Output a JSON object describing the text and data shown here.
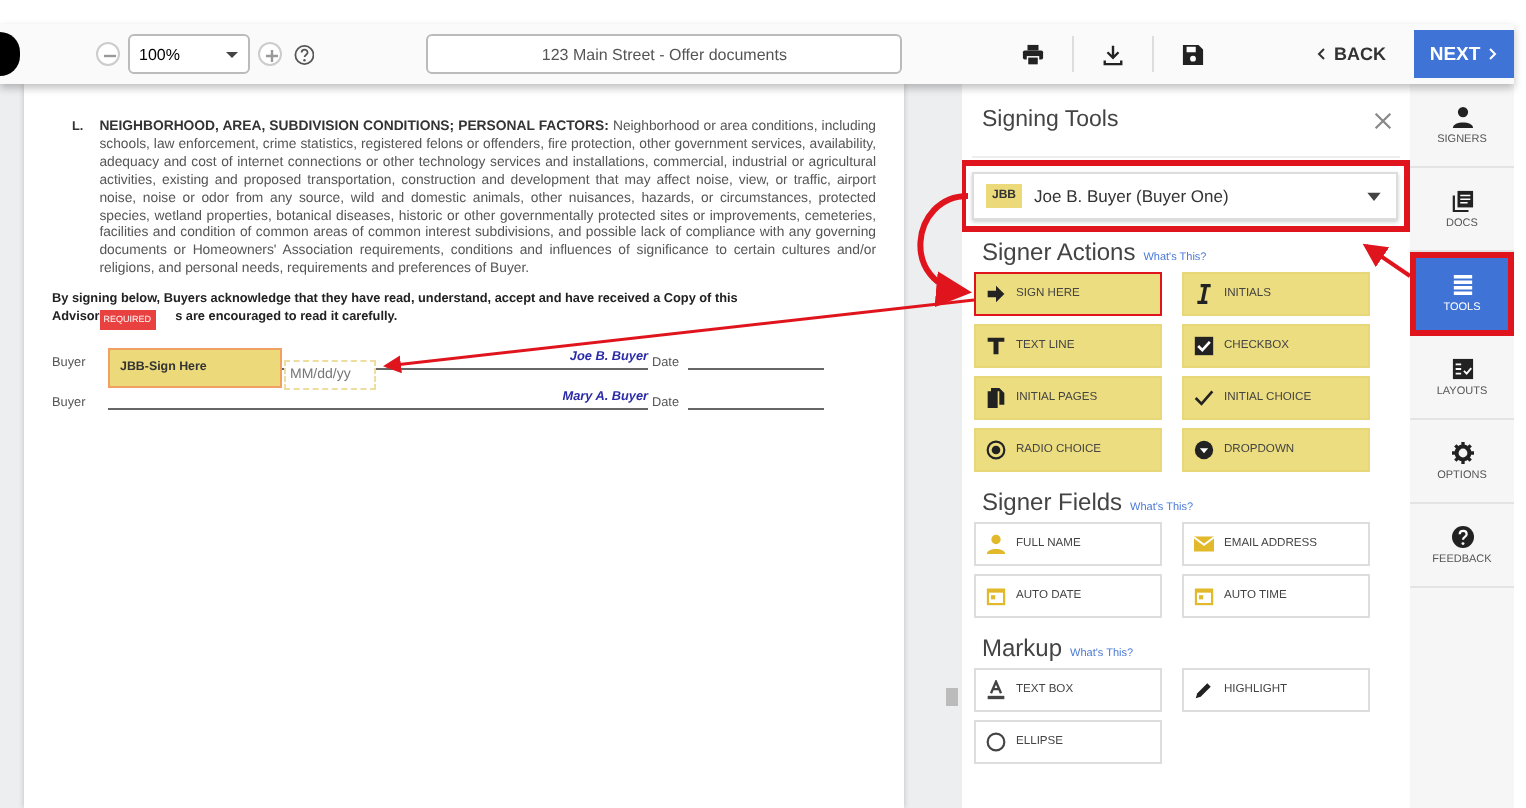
{
  "toolbar": {
    "zoom": "100%",
    "document_title": "123 Main Street - Offer documents",
    "back": "BACK",
    "next": "NEXT"
  },
  "document": {
    "letter": "L.",
    "paragraph": "**NEIGHBORHOOD, AREA, SUBDIVISION CONDITIONS; PERSONAL FACTORS:** Neighborhood or area conditions, including schools, law enforcement, crime statistics, registered felons or offenders, fire protection, other government services, availability, adequacy and cost of internet connections or other technology services and installations, commercial, industrial or agricultural activities, existing and proposed transportation, construction and development that may affect noise, view, or traffic, airport noise, noise or odor from any source, wild and domestic animals, other nuisances, hazards, or circumstances, protected species, wetland properties, botanical diseases, historic or other governmentally protected sites or improvements, cemeteries, facilities and condition of common areas of common interest subdivisions, and possible lack of compliance with any governing documents or Homeowners' Association requirements, conditions and influences of significance to certain cultures and/or religions, and personal needs, requirements and preferences of Buyer.",
    "acknowledgement_start": "By signing below, Buyers acknowledge that they have read, understand, accept and have received a Copy of this",
    "acknowledgement_line2_start": "Advisor",
    "required_badge": "REQUIRED",
    "acknowledgement_line2_end": "s are encouraged to read it carefully.",
    "sign_field": {
      "label": "JBB-Sign Here"
    },
    "date_field": {
      "placeholder": "MM/dd/yy"
    },
    "signature_rows": [
      {
        "label": "Buyer",
        "signer": "Joe B. Buyer",
        "date_label": "Date"
      },
      {
        "label": "Buyer",
        "signer": "Mary A. Buyer",
        "date_label": "Date"
      }
    ]
  },
  "panel": {
    "title": "Signing Tools",
    "signer": {
      "initials": "JBB",
      "name": "Joe B. Buyer (Buyer One)",
      "highlighted": true
    },
    "sections": [
      {
        "title": "Signer Actions",
        "help": "What's This?",
        "kind": "filled",
        "tools": [
          {
            "label": "SIGN HERE",
            "kind": "arrow",
            "highlighted": true
          },
          {
            "label": "INITIALS",
            "kind": "cursor",
            "highlighted": false
          },
          {
            "label": "TEXT LINE",
            "kind": "text",
            "highlighted": false
          },
          {
            "label": "CHECKBOX",
            "kind": "checkbox",
            "highlighted": false
          },
          {
            "label": "INITIAL PAGES",
            "kind": "pages",
            "highlighted": false
          },
          {
            "label": "INITIAL CHOICE",
            "kind": "check",
            "highlighted": false
          },
          {
            "label": "RADIO CHOICE",
            "kind": "radio",
            "highlighted": false
          },
          {
            "label": "DROPDOWN",
            "kind": "dropdown",
            "highlighted": false
          }
        ]
      },
      {
        "title": "Signer Fields",
        "help": "What's This?",
        "kind": "outlined",
        "tools": [
          {
            "label": "FULL NAME",
            "kind": "person",
            "highlighted": false
          },
          {
            "label": "EMAIL ADDRESS",
            "kind": "mail",
            "highlighted": false
          },
          {
            "label": "AUTO DATE",
            "kind": "calendar",
            "highlighted": false
          },
          {
            "label": "AUTO TIME",
            "kind": "calendar",
            "highlighted": false
          }
        ]
      },
      {
        "title": "Markup",
        "help": "What's This?",
        "kind": "outlined",
        "tools": [
          {
            "label": "TEXT BOX",
            "kind": "textbox",
            "highlighted": false
          },
          {
            "label": "HIGHLIGHT",
            "kind": "pen",
            "highlighted": false
          },
          {
            "label": "ELLIPSE",
            "kind": "ellipse",
            "highlighted": false
          }
        ]
      }
    ]
  },
  "nav": [
    {
      "label": "SIGNERS",
      "kind": "person",
      "selected": false
    },
    {
      "label": "DOCS",
      "kind": "docs",
      "selected": false
    },
    {
      "label": "TOOLS",
      "kind": "list",
      "selected": true
    },
    {
      "label": "LAYOUTS",
      "kind": "layouts",
      "selected": false
    },
    {
      "label": "OPTIONS",
      "kind": "gear",
      "selected": false
    },
    {
      "label": "FEEDBACK",
      "kind": "help",
      "selected": false
    }
  ]
}
